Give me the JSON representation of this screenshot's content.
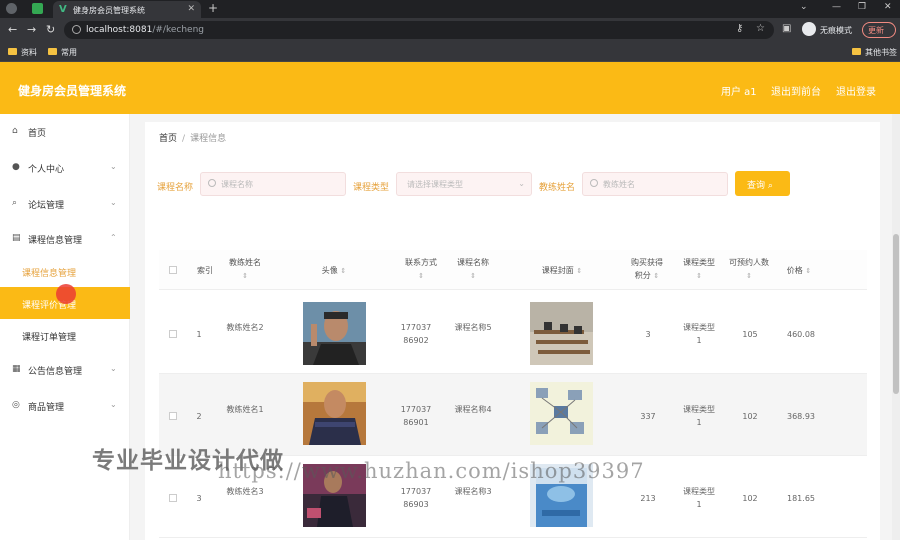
{
  "browser": {
    "tab_title": "健身房会员管理系统",
    "url_host": "localhost:8081",
    "url_path": "/#/kecheng",
    "incognito_label": "无痕模式",
    "update_label": "更新",
    "bookmarks": [
      "资料",
      "常用"
    ],
    "other_bookmarks": "其他书签"
  },
  "header": {
    "title": "健身房会员管理系统",
    "user_label": "用户 a1",
    "back_label": "退出到前台",
    "logout_label": "退出登录"
  },
  "sidebar": {
    "items": [
      {
        "label": "首页"
      },
      {
        "label": "个人中心"
      },
      {
        "label": "论坛管理"
      },
      {
        "label": "课程信息管理"
      },
      {
        "label": "公告信息管理"
      },
      {
        "label": "商品管理"
      }
    ],
    "sub_items": [
      {
        "label": "课程信息管理"
      },
      {
        "label": "课程评价管理"
      },
      {
        "label": "课程订单管理"
      }
    ]
  },
  "breadcrumb": {
    "home": "首页",
    "current": "课程信息"
  },
  "filters": {
    "course_name_label": "课程名称",
    "course_name_placeholder": "课程名称",
    "course_type_label": "课程类型",
    "course_type_placeholder": "请选择课程类型",
    "coach_name_label": "教练姓名",
    "coach_name_placeholder": "教练姓名",
    "query_label": "查询"
  },
  "table": {
    "headers": {
      "index": "索引",
      "coach_name": "教练姓名",
      "avatar": "头像",
      "contact": "联系方式",
      "course_name": "课程名称",
      "cover": "课程封面",
      "points": "购买获得积分",
      "course_type": "课程类型",
      "capacity": "可预约人数",
      "price": "价格"
    },
    "rows": [
      {
        "index": "1",
        "coach_name": "教练姓名2",
        "contact": "17703786902",
        "course_name": "课程名称5",
        "points": "3",
        "course_type": "课程类型1",
        "capacity": "105",
        "price": "460.08"
      },
      {
        "index": "2",
        "coach_name": "教练姓名1",
        "contact": "17703786901",
        "course_name": "课程名称4",
        "points": "337",
        "course_type": "课程类型1",
        "capacity": "102",
        "price": "368.93"
      },
      {
        "index": "3",
        "coach_name": "教练姓名3",
        "contact": "17703786903",
        "course_name": "课程名称3",
        "points": "213",
        "course_type": "课程类型1",
        "capacity": "102",
        "price": "181.65"
      }
    ]
  },
  "watermark": {
    "line1": "专业毕业设计代做",
    "line2": "https://www.huzhan.com/ishop39397"
  },
  "colors": {
    "accent": "#fbba15",
    "active_text": "#e6a23c"
  }
}
